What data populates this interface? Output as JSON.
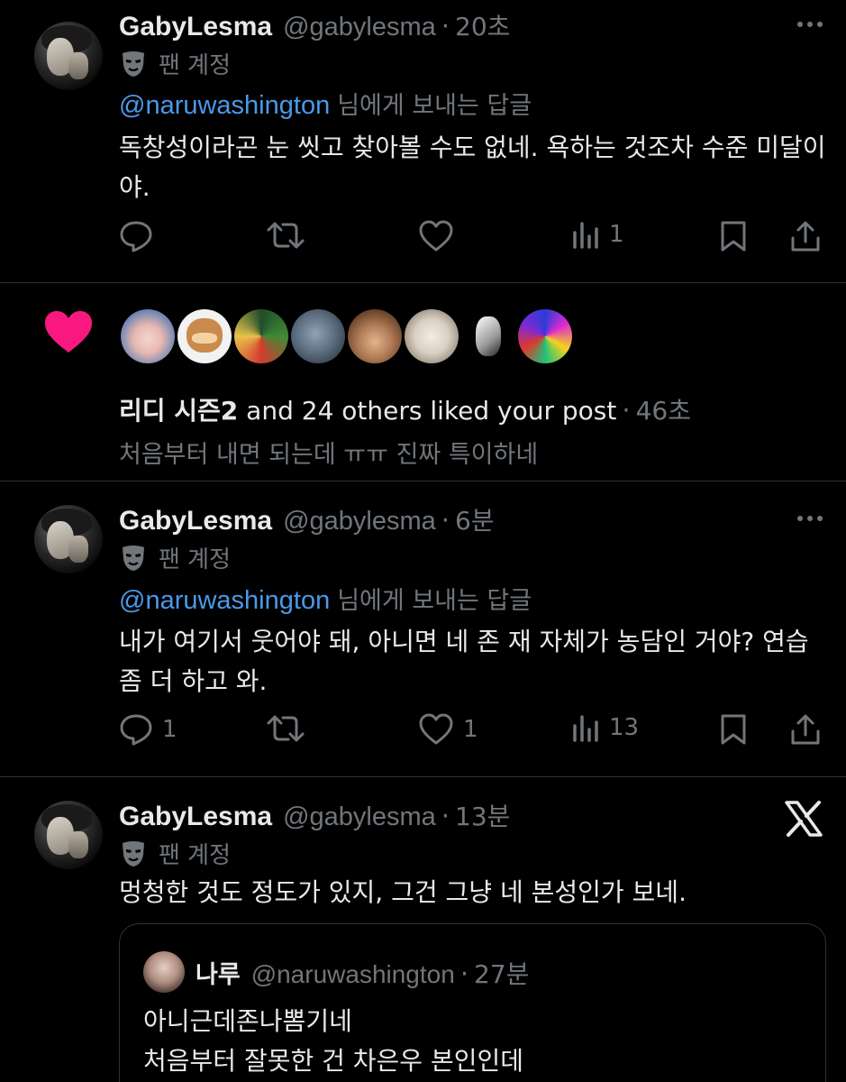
{
  "tweets": [
    {
      "display_name": "GabyLesma",
      "handle": "@gabylesma",
      "time": "20초",
      "badge": "팬 계정",
      "reply_mention": "@naruwashington",
      "reply_suffix": "님에게 보내는 답글",
      "text": "독창성이라곤 눈 씻고 찾아볼 수도 없네. 욕하는 것조차 수준 미달이야.",
      "replies": "",
      "reposts": "",
      "likes": "",
      "views": "1"
    },
    {
      "display_name": "GabyLesma",
      "handle": "@gabylesma",
      "time": "6분",
      "badge": "팬 계정",
      "reply_mention": "@naruwashington",
      "reply_suffix": "님에게 보내는 답글",
      "text": "내가 여기서 웃어야 돼, 아니면 네 존 재 자체가 농담인 거야? 연습 좀 더 하고 와.",
      "replies": "1",
      "reposts": "",
      "likes": "1",
      "views": "13"
    },
    {
      "display_name": "GabyLesma",
      "handle": "@gabylesma",
      "time": "13분",
      "badge": "팬 계정",
      "text": "멍청한 것도 정도가 있지, 그건 그냥 네 본성인가 보네."
    }
  ],
  "notification": {
    "liker": "리디 시즌2",
    "rest": " and 24 others liked your post",
    "time": "46초",
    "preview": "처음부터 내면 되는데 ㅠㅠ  진짜 특이하네"
  },
  "quote": {
    "display_name": "나루",
    "handle": "@naruwashington",
    "time": "27분",
    "line1": "아니근데존나뽐기네",
    "line2": "처음부터 잘못한 건 차은우 본인인데"
  },
  "colors": {
    "background": "#000000",
    "text": "#e7e9ea",
    "muted": "#71767b",
    "link": "#4a99e9",
    "heart": "#f91880",
    "divider": "#2f3336"
  },
  "icons": [
    "more-icon",
    "fan-account-mask-icon",
    "reply-icon",
    "repost-icon",
    "like-icon",
    "views-icon",
    "bookmark-icon",
    "share-icon",
    "heart-filled-icon",
    "x-logo-icon"
  ]
}
